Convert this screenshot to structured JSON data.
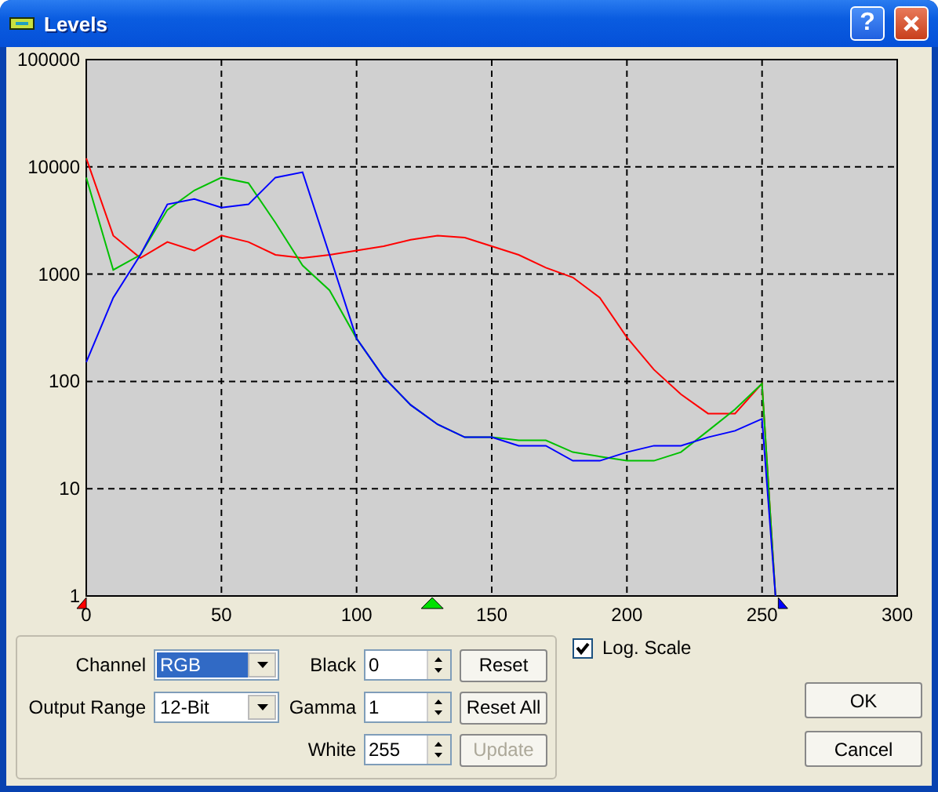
{
  "window": {
    "title": "Levels",
    "help_button": "?"
  },
  "histogram": {
    "x_axis_labels": [
      "0",
      "50",
      "100",
      "150",
      "200",
      "250",
      "300"
    ],
    "y_axis_labels": [
      "100000",
      "10000",
      "1000",
      "100",
      "10",
      "1"
    ]
  },
  "settings": {
    "channel": {
      "label": "Channel",
      "value": "RGB",
      "focused": true
    },
    "output_range": {
      "label": "Output Range",
      "value": "12-Bit",
      "focused": false
    }
  },
  "levels": [
    {
      "label": "Black",
      "value": "0"
    },
    {
      "label": "Gamma",
      "value": "1"
    },
    {
      "label": "White",
      "value": "255"
    }
  ],
  "level_buttons": [
    {
      "label": "Reset",
      "disabled": false
    },
    {
      "label": "Reset All",
      "disabled": false
    },
    {
      "label": "Update",
      "disabled": true
    }
  ],
  "log_scale": {
    "label": "Log. Scale",
    "checked": true
  },
  "dialog_buttons": [
    "OK",
    "Cancel"
  ]
}
